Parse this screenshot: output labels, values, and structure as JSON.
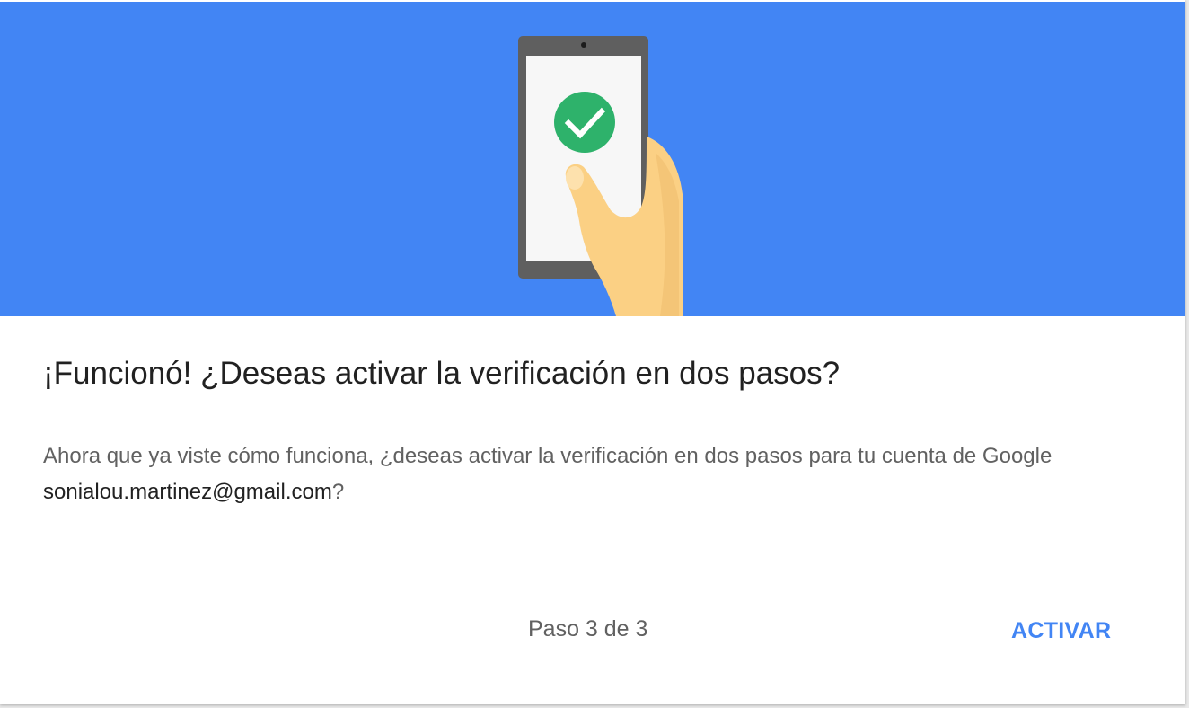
{
  "colors": {
    "hero_background": "#4285f4",
    "accent": "#4285f4",
    "success": "#2eb26b"
  },
  "illustration": {
    "icon": "phone-checkmark-icon"
  },
  "dialog": {
    "title": "¡Funcionó! ¿Deseas activar la verificación en dos pasos?",
    "description_before": "Ahora que ya viste cómo funciona, ¿deseas activar la verificación en dos pasos para tu cuenta de Google ",
    "email": "sonialou.martinez@gmail.com",
    "description_after": "?",
    "step_label": "Paso 3 de 3",
    "activate_label": "ACTIVAR"
  }
}
